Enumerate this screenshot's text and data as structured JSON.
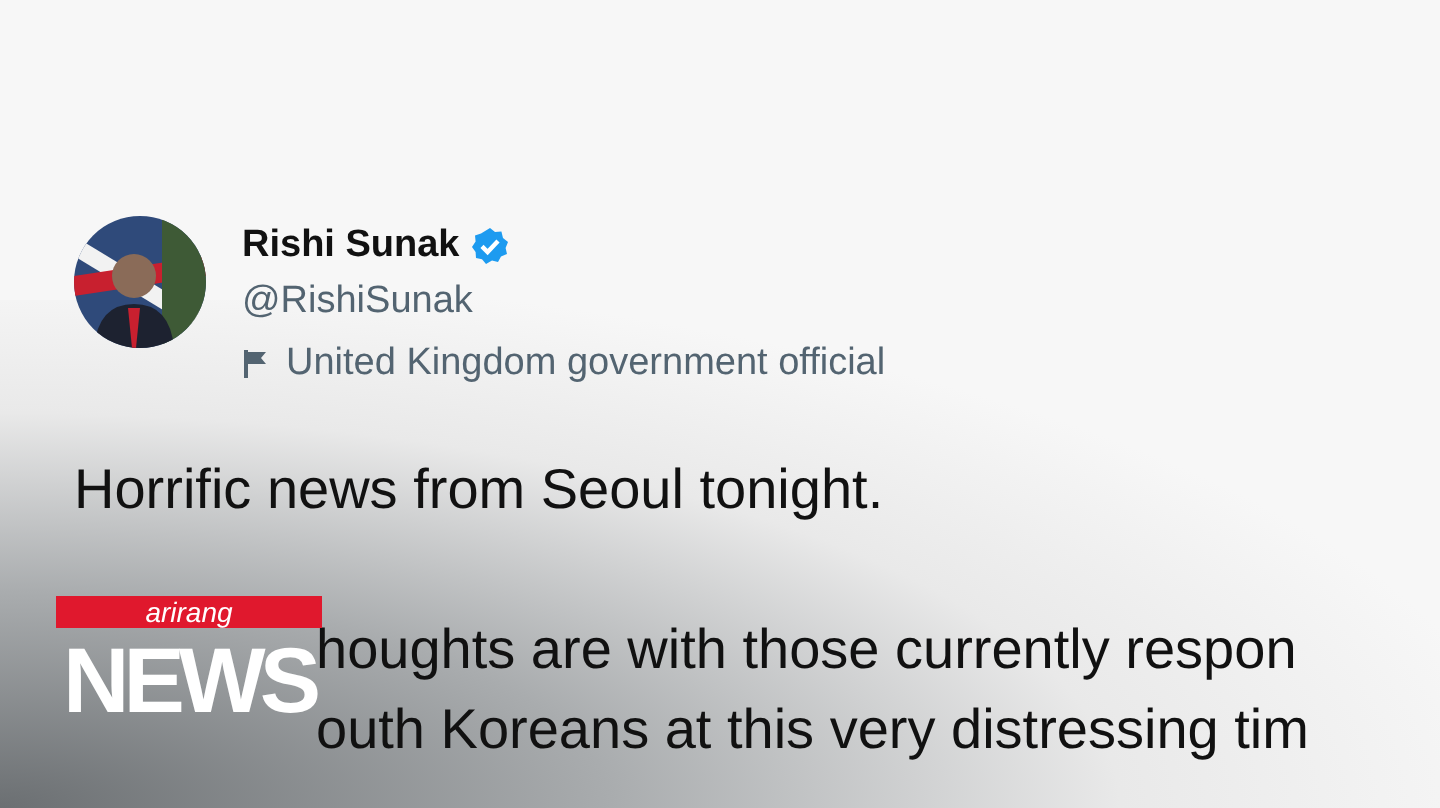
{
  "tweet": {
    "author": {
      "name": "Rishi Sunak",
      "verified": true,
      "handle": "@RishiSunak",
      "label": "United Kingdom government official"
    },
    "lines": [
      {
        "text": "Horrific news from Seoul tonight.",
        "kind": "full"
      },
      {
        "text": "houghts are with those currently respon",
        "kind": "covered"
      },
      {
        "text": "outh Koreans at this very distressing tim",
        "kind": "covered"
      }
    ]
  },
  "logo": {
    "top": "arirang",
    "main": "NEWS"
  }
}
